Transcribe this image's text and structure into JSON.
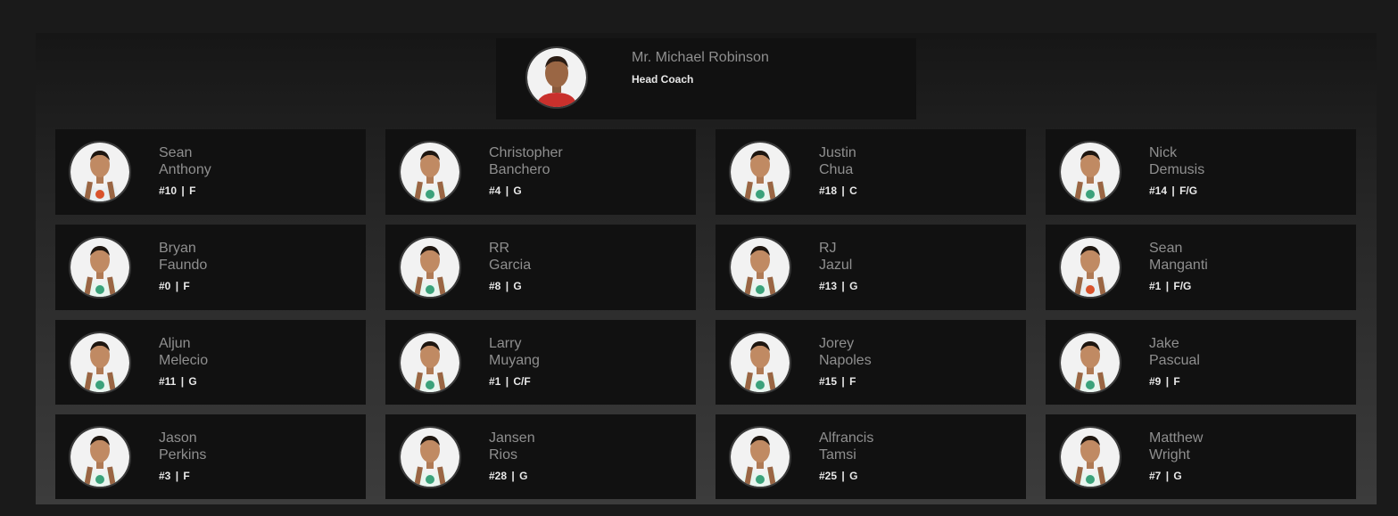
{
  "coach": {
    "name": "Mr. Michael Robinson",
    "role": "Head Coach",
    "jersey_color": "#c9302c"
  },
  "players": [
    {
      "first": "Sean",
      "last": "Anthony",
      "number": "#10",
      "position": "F",
      "jersey": "#e8eef0",
      "trim": "#d9532c"
    },
    {
      "first": "Christopher",
      "last": "Banchero",
      "number": "#4",
      "position": "G",
      "jersey": "#e8f5ef",
      "trim": "#3aa27a"
    },
    {
      "first": "Justin",
      "last": "Chua",
      "number": "#18",
      "position": "C",
      "jersey": "#e8f5ef",
      "trim": "#3aa27a"
    },
    {
      "first": "Nick",
      "last": "Demusis",
      "number": "#14",
      "position": "F/G",
      "jersey": "#e8f5ef",
      "trim": "#3aa27a"
    },
    {
      "first": "Bryan",
      "last": "Faundo",
      "number": "#0",
      "position": "F",
      "jersey": "#e8f5ef",
      "trim": "#3aa27a"
    },
    {
      "first": "RR",
      "last": "Garcia",
      "number": "#8",
      "position": "G",
      "jersey": "#e8f5ef",
      "trim": "#3aa27a"
    },
    {
      "first": "RJ",
      "last": "Jazul",
      "number": "#13",
      "position": "G",
      "jersey": "#e8f5ef",
      "trim": "#3aa27a"
    },
    {
      "first": "Sean",
      "last": "Manganti",
      "number": "#1",
      "position": "F/G",
      "jersey": "#e8eef0",
      "trim": "#d9532c"
    },
    {
      "first": "Aljun",
      "last": "Melecio",
      "number": "#11",
      "position": "G",
      "jersey": "#e8f5ef",
      "trim": "#3aa27a"
    },
    {
      "first": "Larry",
      "last": "Muyang",
      "number": "#1",
      "position": "C/F",
      "jersey": "#e8f5ef",
      "trim": "#3aa27a"
    },
    {
      "first": "Jorey",
      "last": "Napoles",
      "number": "#15",
      "position": "F",
      "jersey": "#e8f5ef",
      "trim": "#3aa27a"
    },
    {
      "first": "Jake",
      "last": "Pascual",
      "number": "#9",
      "position": "F",
      "jersey": "#e8f5ef",
      "trim": "#3aa27a"
    },
    {
      "first": "Jason",
      "last": "Perkins",
      "number": "#3",
      "position": "F",
      "jersey": "#e8f5ef",
      "trim": "#3aa27a"
    },
    {
      "first": "Jansen",
      "last": "Rios",
      "number": "#28",
      "position": "G",
      "jersey": "#e8f5ef",
      "trim": "#3aa27a"
    },
    {
      "first": "Alfrancis",
      "last": "Tamsi",
      "number": "#25",
      "position": "G",
      "jersey": "#e8f5ef",
      "trim": "#3aa27a"
    },
    {
      "first": "Matthew",
      "last": "Wright",
      "number": "#7",
      "position": "G",
      "jersey": "#e8f5ef",
      "trim": "#3aa27a"
    }
  ]
}
